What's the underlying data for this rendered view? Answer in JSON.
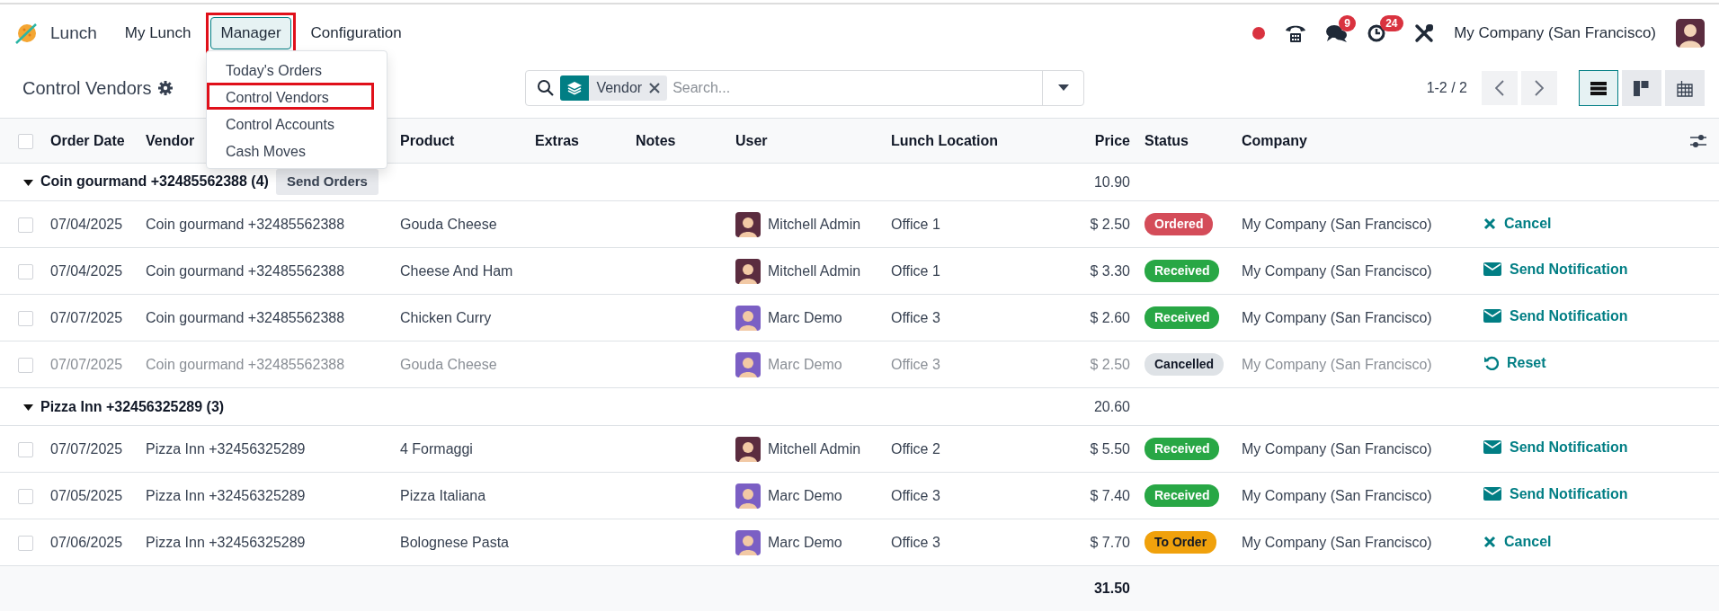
{
  "app": {
    "name": "Lunch"
  },
  "menu": [
    {
      "label": "My Lunch",
      "selected": false,
      "highlighted": false
    },
    {
      "label": "Manager",
      "selected": true,
      "highlighted": true
    },
    {
      "label": "Configuration",
      "selected": false,
      "highlighted": false
    }
  ],
  "dropdown": {
    "items": [
      {
        "label": "Today's Orders",
        "highlighted": false
      },
      {
        "label": "Control Vendors",
        "highlighted": true
      },
      {
        "label": "Control Accounts",
        "highlighted": false
      },
      {
        "label": "Cash Moves",
        "highlighted": false
      }
    ]
  },
  "systray": {
    "messages_count": "9",
    "activities_count": "24",
    "company": "My Company (San Francisco)"
  },
  "breadcrumb": {
    "title": "Control Vendors"
  },
  "search": {
    "facets": [
      {
        "label": "Vendor"
      }
    ],
    "placeholder": "Search..."
  },
  "pager": {
    "value": "1-2 / 2"
  },
  "views": [
    {
      "kind": "list",
      "selected": true
    },
    {
      "kind": "kanban",
      "selected": false
    },
    {
      "kind": "pivot",
      "selected": false
    }
  ],
  "table": {
    "all_checked": false,
    "columns": [
      "Order Date",
      "Vendor",
      "Product",
      "Extras",
      "Notes",
      "User",
      "Lunch Location",
      "Price",
      "Status",
      "Company"
    ],
    "groups": [
      {
        "label": "Coin gourmand +32485562388 (4)",
        "expanded": true,
        "button": "Send Orders",
        "total": "10.90",
        "rows": [
          {
            "checked": false,
            "muted": false,
            "date": "07/04/2025",
            "vendor": "Coin gourmand +32485562388",
            "product": "Gouda Cheese",
            "user": {
              "name": "Mitchell Admin",
              "color": "#5b2c3f"
            },
            "location": "Office 1",
            "price": "$ 2.50",
            "status": {
              "label": "Ordered",
              "kind": "danger"
            },
            "company": "My Company (San Francisco)",
            "action": {
              "label": "Cancel",
              "kind": "cancel"
            }
          },
          {
            "checked": false,
            "muted": false,
            "date": "07/04/2025",
            "vendor": "Coin gourmand +32485562388",
            "product": "Cheese And Ham",
            "user": {
              "name": "Mitchell Admin",
              "color": "#5b2c3f"
            },
            "location": "Office 1",
            "price": "$ 3.30",
            "status": {
              "label": "Received",
              "kind": "success"
            },
            "company": "My Company (San Francisco)",
            "action": {
              "label": "Send Notification",
              "kind": "notify"
            }
          },
          {
            "checked": false,
            "muted": false,
            "date": "07/07/2025",
            "vendor": "Coin gourmand +32485562388",
            "product": "Chicken Curry",
            "user": {
              "name": "Marc Demo",
              "color": "#7b5fc4"
            },
            "location": "Office 3",
            "price": "$ 2.60",
            "status": {
              "label": "Received",
              "kind": "success"
            },
            "company": "My Company (San Francisco)",
            "action": {
              "label": "Send Notification",
              "kind": "notify"
            }
          },
          {
            "checked": false,
            "muted": true,
            "date": "07/07/2025",
            "vendor": "Coin gourmand +32485562388",
            "product": "Gouda Cheese",
            "user": {
              "name": "Marc Demo",
              "color": "#7b5fc4"
            },
            "location": "Office 3",
            "price": "$ 2.50",
            "status": {
              "label": "Cancelled",
              "kind": "secondary"
            },
            "company": "My Company (San Francisco)",
            "action": {
              "label": "Reset",
              "kind": "reset"
            }
          }
        ]
      },
      {
        "label": "Pizza Inn +32456325289 (3)",
        "expanded": true,
        "total": "20.60",
        "rows": [
          {
            "checked": false,
            "muted": false,
            "date": "07/07/2025",
            "vendor": "Pizza Inn +32456325289",
            "product": "4 Formaggi",
            "user": {
              "name": "Mitchell Admin",
              "color": "#5b2c3f"
            },
            "location": "Office 2",
            "price": "$ 5.50",
            "status": {
              "label": "Received",
              "kind": "success"
            },
            "company": "My Company (San Francisco)",
            "action": {
              "label": "Send Notification",
              "kind": "notify"
            }
          },
          {
            "checked": false,
            "muted": false,
            "date": "07/05/2025",
            "vendor": "Pizza Inn +32456325289",
            "product": "Pizza Italiana",
            "user": {
              "name": "Marc Demo",
              "color": "#7b5fc4"
            },
            "location": "Office 3",
            "price": "$ 7.40",
            "status": {
              "label": "Received",
              "kind": "success"
            },
            "company": "My Company (San Francisco)",
            "action": {
              "label": "Send Notification",
              "kind": "notify"
            }
          },
          {
            "checked": false,
            "muted": false,
            "date": "07/06/2025",
            "vendor": "Pizza Inn +32456325289",
            "product": "Bolognese Pasta",
            "user": {
              "name": "Marc Demo",
              "color": "#7b5fc4"
            },
            "location": "Office 3",
            "price": "$ 7.70",
            "status": {
              "label": "To Order",
              "kind": "warning"
            },
            "company": "My Company (San Francisco)",
            "action": {
              "label": "Cancel",
              "kind": "cancel"
            }
          }
        ]
      }
    ],
    "total": "31.50"
  }
}
